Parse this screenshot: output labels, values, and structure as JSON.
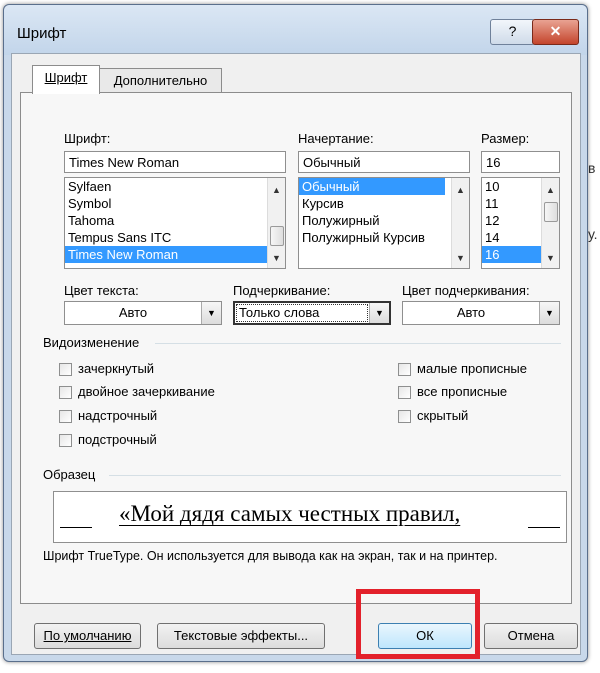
{
  "window": {
    "title": "Шрифт",
    "help": "?",
    "close": "✕"
  },
  "tabs": [
    {
      "label": "Шрифт"
    },
    {
      "label": "Дополнительно"
    }
  ],
  "font": {
    "label": "Шрифт:",
    "value": "Times New Roman",
    "items": [
      "Sylfaen",
      "Symbol",
      "Tahoma",
      "Tempus Sans ITC",
      "Times New Roman"
    ]
  },
  "style": {
    "label": "Начертание:",
    "value": "Обычный",
    "items": [
      "Обычный",
      "Курсив",
      "Полужирный",
      "Полужирный Курсив"
    ]
  },
  "size": {
    "label": "Размер:",
    "value": "16",
    "items": [
      "10",
      "11",
      "12",
      "14",
      "16"
    ]
  },
  "colors": {
    "text_color_label": "Цвет текста:",
    "text_color_value": "Авто",
    "underline_label": "Подчеркивание:",
    "underline_value": "Только слова",
    "underline_color_label": "Цвет подчеркивания:",
    "underline_color_value": "Авто"
  },
  "effects": {
    "section_label": "Видоизменение",
    "strikethrough": "зачеркнутый",
    "double_strikethrough": "двойное зачеркивание",
    "superscript": "надстрочный",
    "subscript": "подстрочный",
    "small_caps": "малые прописные",
    "all_caps": "все прописные",
    "hidden": "скрытый"
  },
  "preview": {
    "section_label": "Образец",
    "text": "«Мой дядя самых честных правил,",
    "note": "Шрифт TrueType. Он используется для вывода как на экран, так и на принтер."
  },
  "buttons": {
    "default": "По умолчанию",
    "text_effects": "Текстовые эффекты...",
    "ok": "ОК",
    "cancel": "Отмена"
  },
  "colors_hex": {
    "selection": "#3399ff",
    "highlight_box": "#e3212b",
    "window_frame": "#c8d8ea"
  }
}
